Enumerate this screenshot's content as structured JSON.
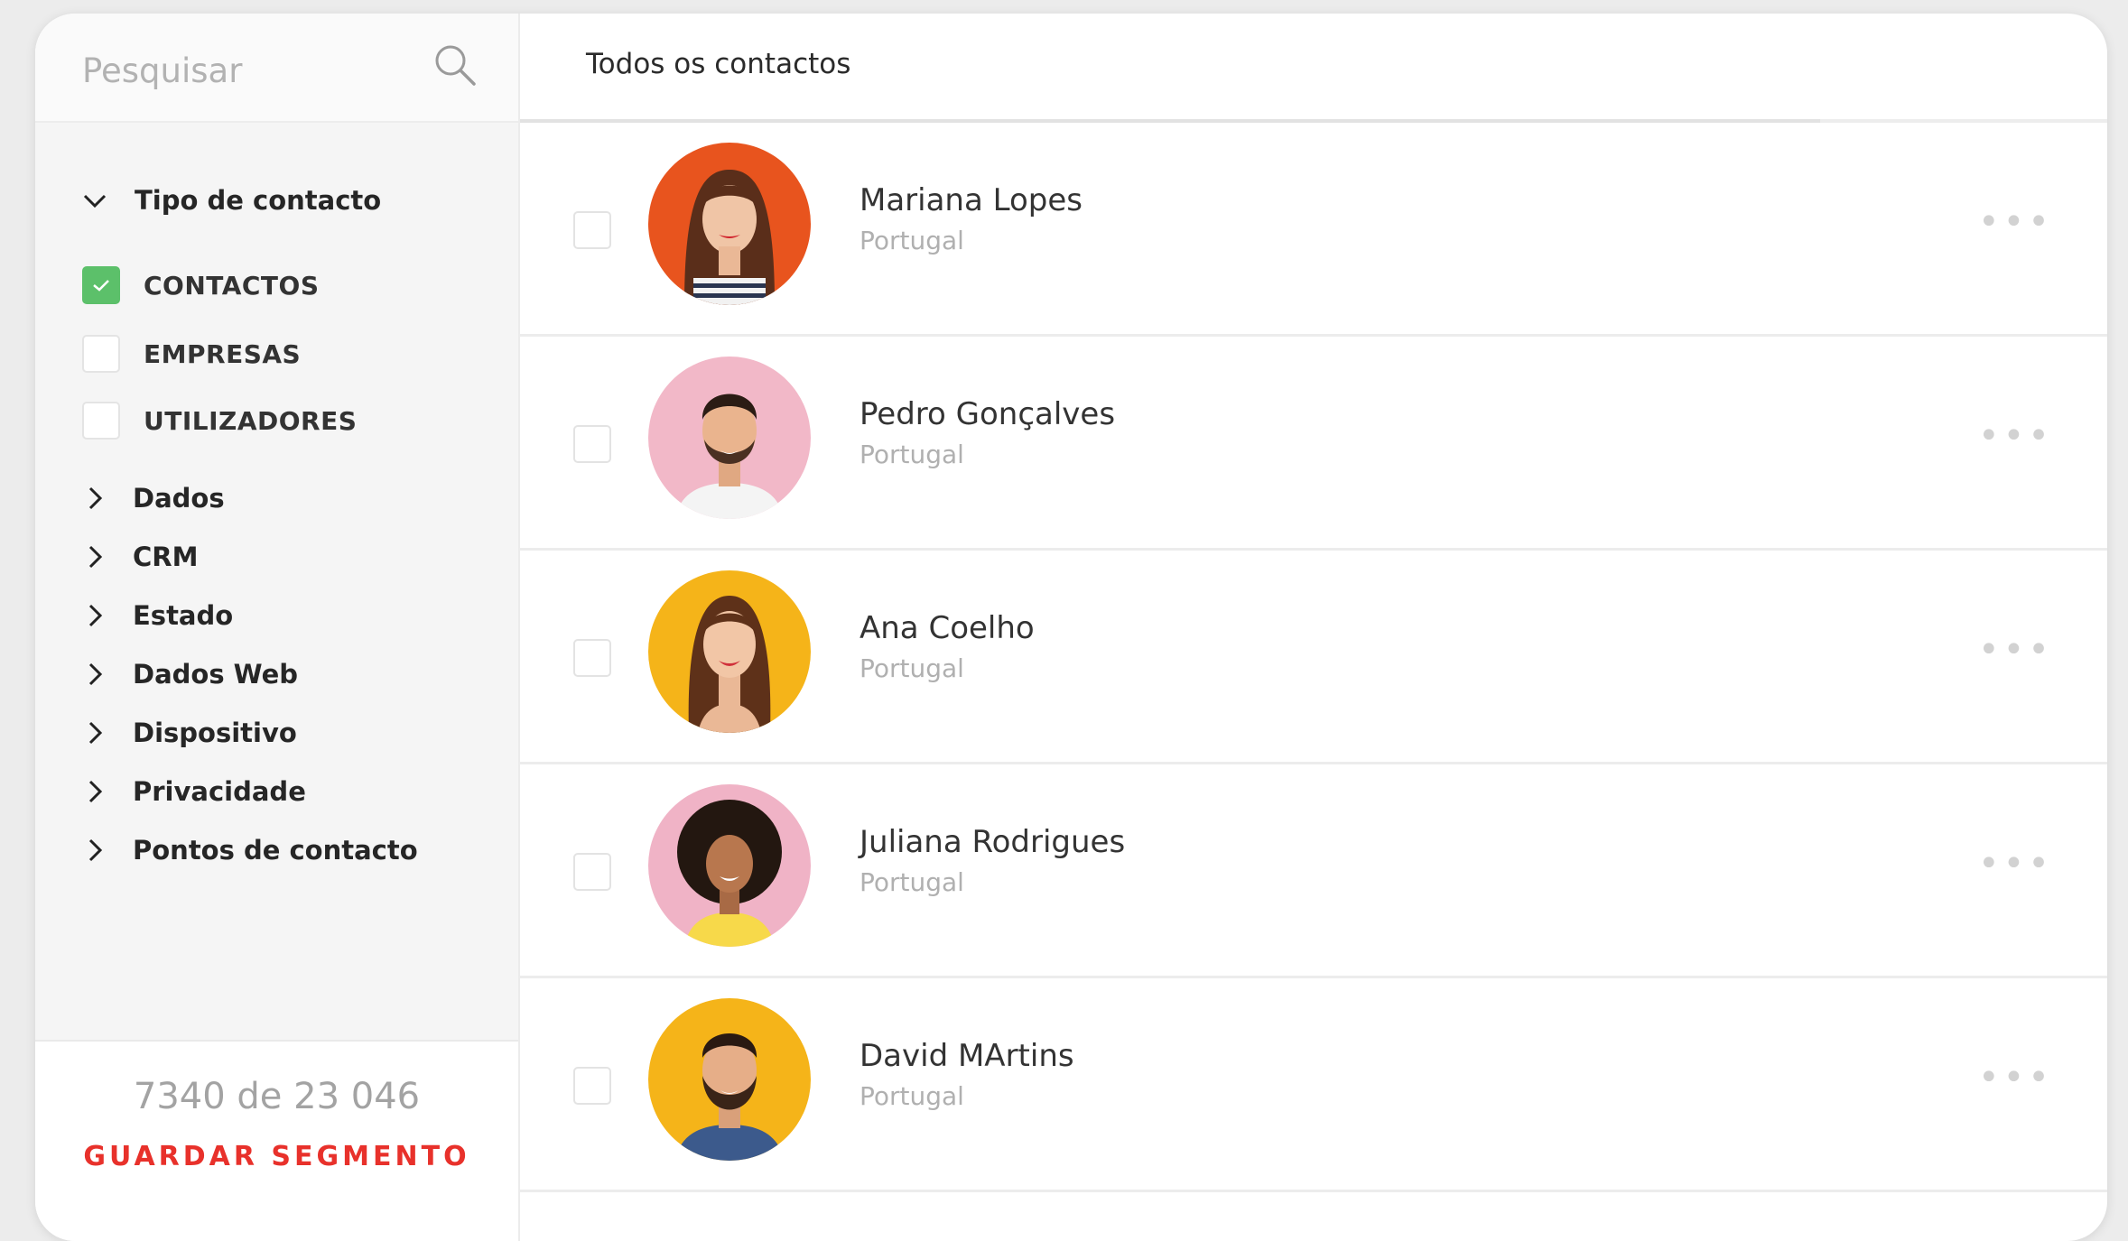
{
  "search": {
    "placeholder": "Pesquisar",
    "value": ""
  },
  "sidebar": {
    "contact_type": {
      "label": "Tipo de contacto",
      "options": [
        {
          "label": "CONTACTOS",
          "checked": true
        },
        {
          "label": "EMPRESAS",
          "checked": false
        },
        {
          "label": "UTILIZADORES",
          "checked": false
        }
      ]
    },
    "sections": [
      "Dados",
      "CRM",
      "Estado",
      "Dados Web",
      "Dispositivo",
      "Privacidade",
      "Pontos de contacto"
    ],
    "count": "7340 de 23 046",
    "save_segment": "GUARDAR SEGMENTO"
  },
  "main": {
    "title": "Todos os contactos",
    "contacts": [
      {
        "name": "Mariana Lopes",
        "country": "Portugal",
        "avatar_bg": "#e8541e"
      },
      {
        "name": "Pedro Gonçalves",
        "country": "Portugal",
        "avatar_bg": "#f2b8c8"
      },
      {
        "name": "Ana Coelho",
        "country": "Portugal",
        "avatar_bg": "#f5b419"
      },
      {
        "name": "Juliana Rodrigues",
        "country": "Portugal",
        "avatar_bg": "#f0b3c6"
      },
      {
        "name": "David MArtins",
        "country": "Portugal",
        "avatar_bg": "#f5b419"
      }
    ],
    "more_glyph": "•••"
  },
  "colors": {
    "accent_red": "#e8312b",
    "check_green": "#5cc06a"
  }
}
